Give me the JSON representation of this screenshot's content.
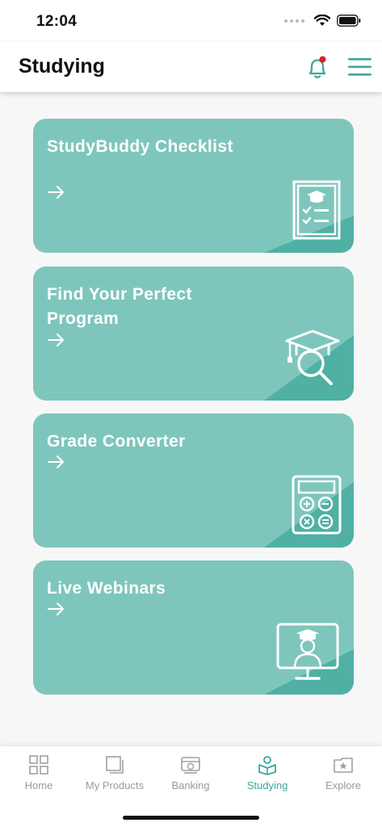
{
  "status_bar": {
    "time": "12:04"
  },
  "header": {
    "title": "Studying",
    "has_notification": true
  },
  "colors": {
    "accent": "#3aa89c",
    "card_bg": "#7ec6bc",
    "card_stripe": "#4fb0a3",
    "notification_dot": "#e02020"
  },
  "cards": [
    {
      "title": "StudyBuddy Checklist",
      "icon": "checklist-icon"
    },
    {
      "title": "Find Your Perfect Program",
      "icon": "graduate-search-icon"
    },
    {
      "title": "Grade Converter",
      "icon": "calculator-icon"
    },
    {
      "title": "Live Webinars",
      "icon": "webinar-icon"
    }
  ],
  "bottom_nav": {
    "items": [
      {
        "label": "Home",
        "icon": "home-grid-icon",
        "active": false
      },
      {
        "label": "My Products",
        "icon": "products-icon",
        "active": false
      },
      {
        "label": "Banking",
        "icon": "bank-icon",
        "active": false
      },
      {
        "label": "Studying",
        "icon": "study-book-icon",
        "active": true
      },
      {
        "label": "Explore",
        "icon": "explore-folder-icon",
        "active": false
      }
    ]
  }
}
